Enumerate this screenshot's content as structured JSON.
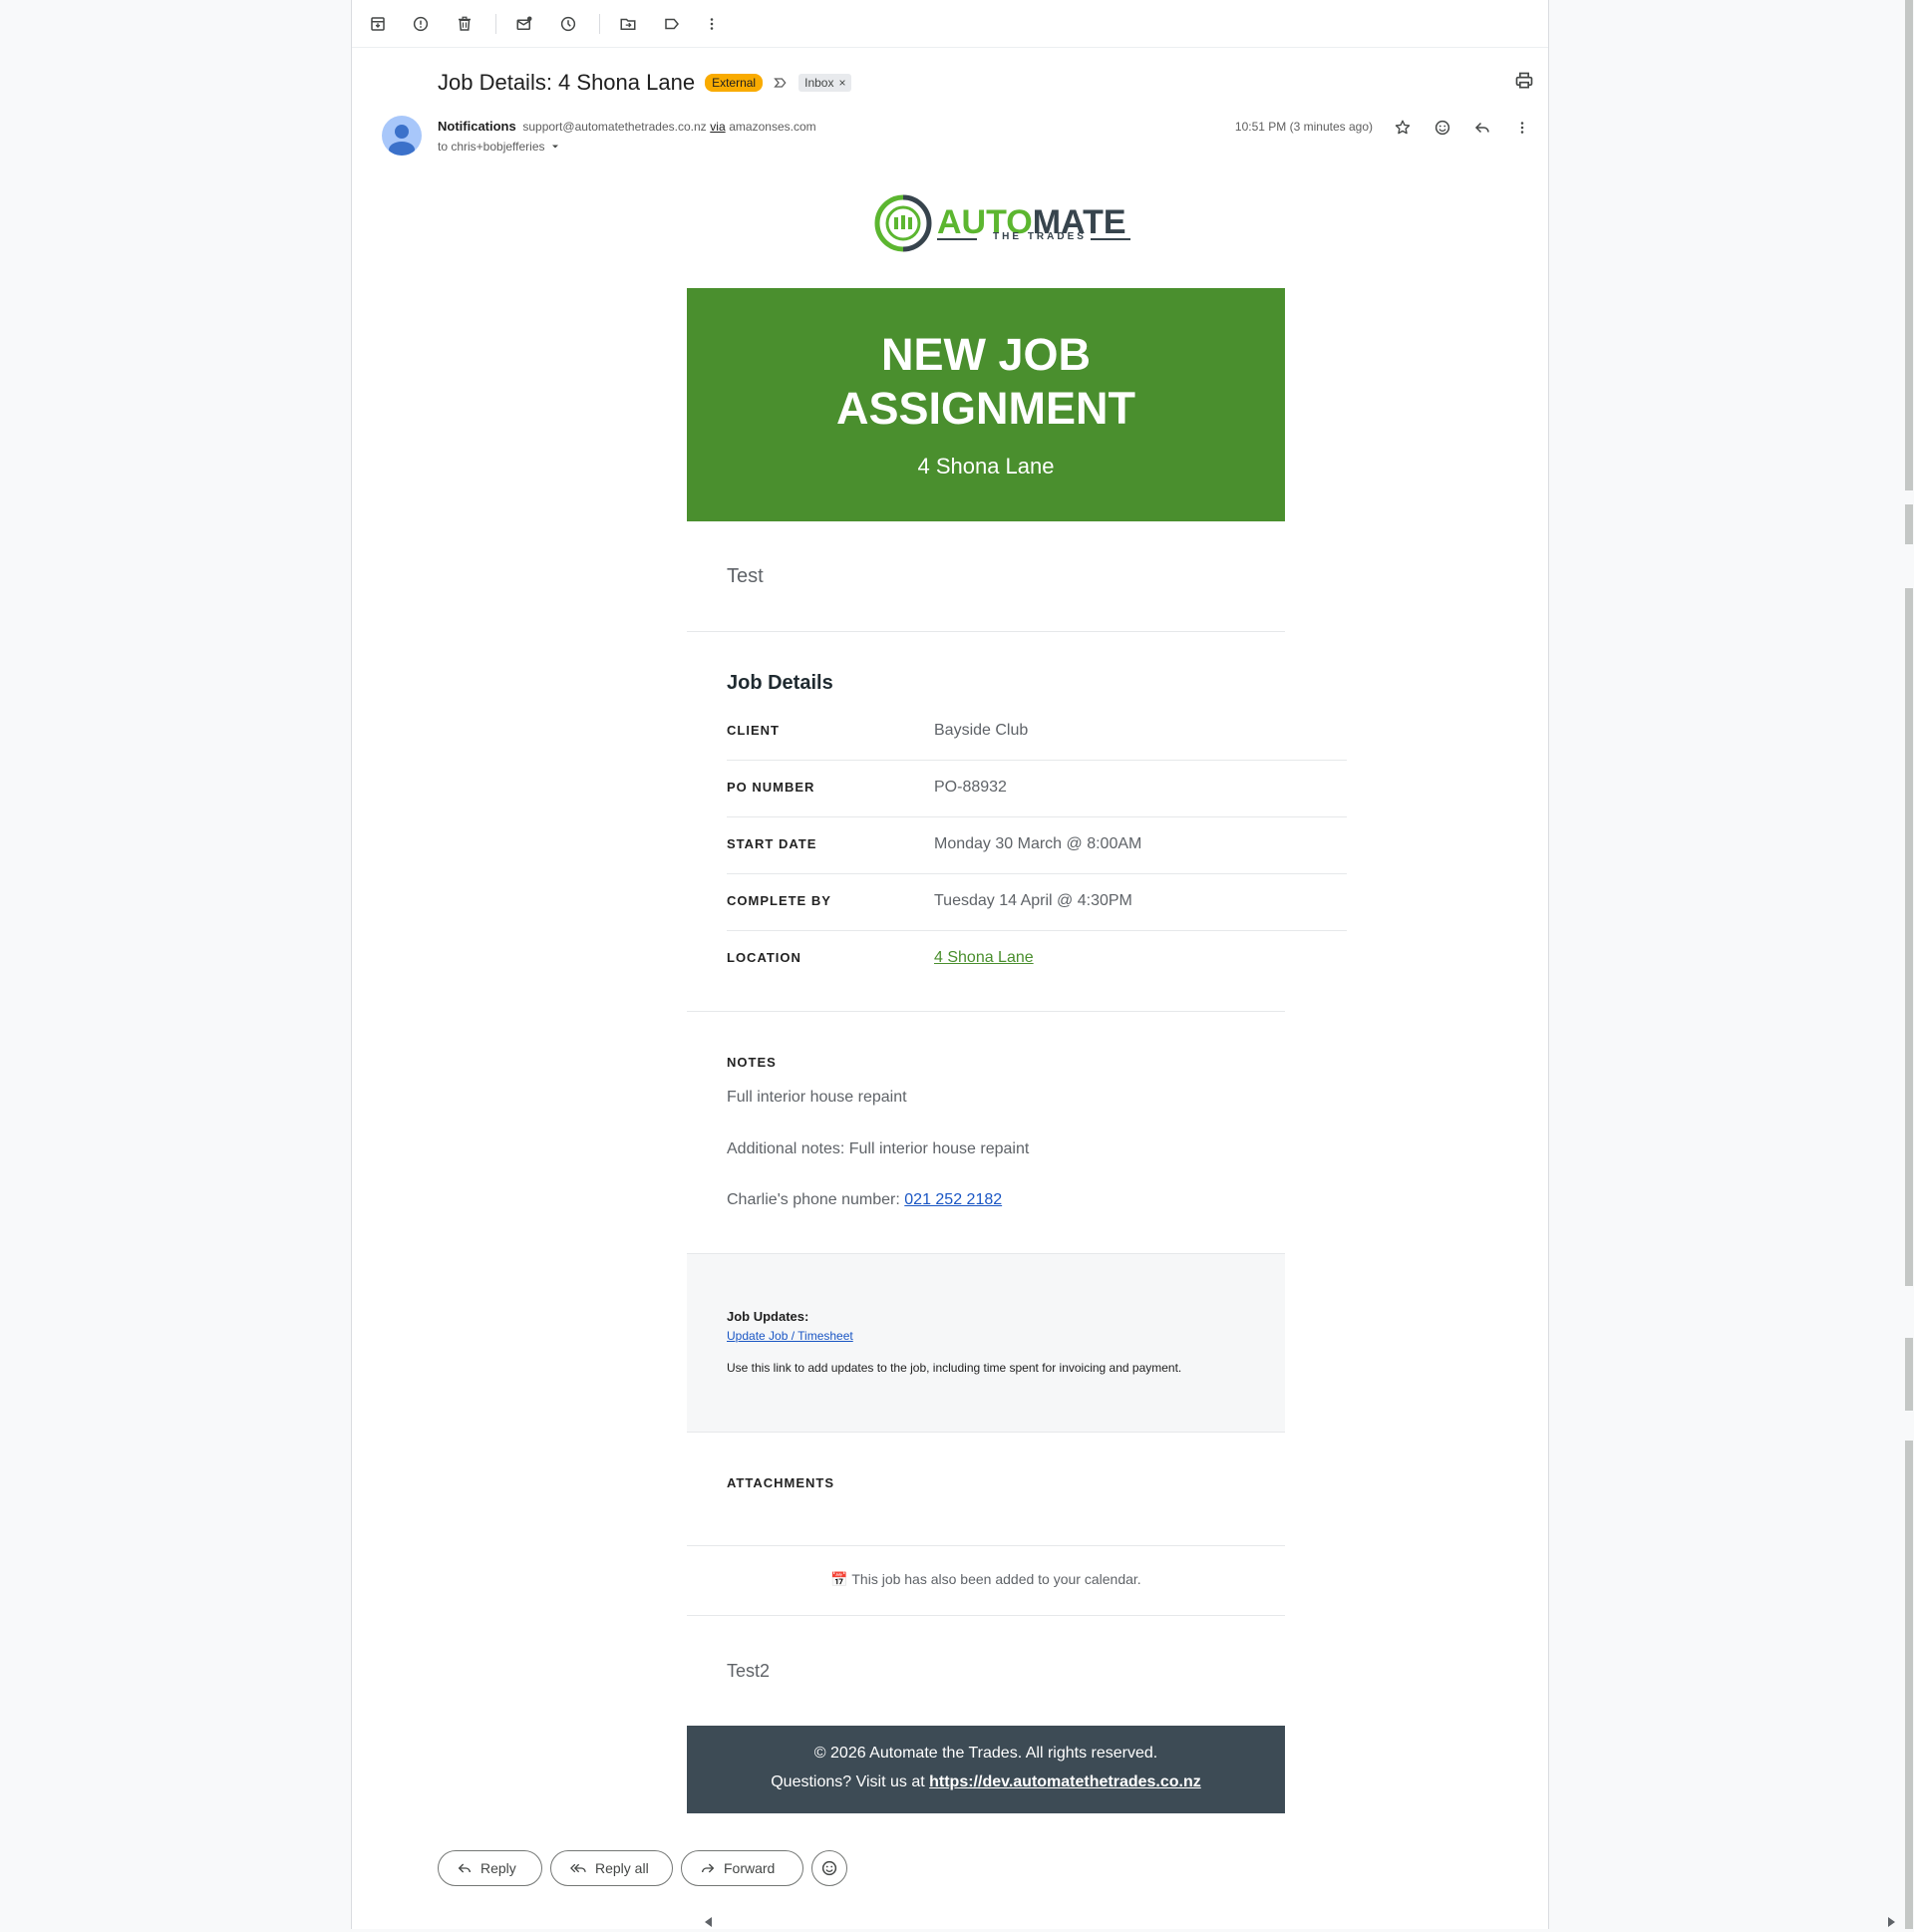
{
  "toolbar": {
    "icons": [
      "archive-icon",
      "report-spam-icon",
      "delete-icon",
      "mark-unread-icon",
      "snooze-icon",
      "move-to-icon",
      "label-icon",
      "more-vert-icon"
    ]
  },
  "header": {
    "subject": "Job Details: 4 Shona Lane",
    "external_badge": "External",
    "inbox_chip": "Inbox",
    "inbox_remove": "×",
    "sender_name": "Notifications",
    "sender_email": "support@automatethetrades.co.nz",
    "via": "via",
    "via_domain": "amazonses.com",
    "to_line": "to chris+bobjefferies",
    "timestamp": "10:51 PM (3 minutes ago)"
  },
  "logo": {
    "auto": "AUTO",
    "mate": "MATE",
    "tagline": "THE TRADES"
  },
  "banner": {
    "title_line1": "NEW JOB",
    "title_line2": "ASSIGNMENT",
    "subtitle": "4 Shona Lane",
    "color": "#4a8f2e"
  },
  "intro_text": "Test",
  "job_details": {
    "heading": "Job Details",
    "rows": [
      {
        "label": "CLIENT",
        "value": "Bayside Club"
      },
      {
        "label": "PO NUMBER",
        "value": "PO-88932"
      },
      {
        "label": "START DATE",
        "value": "Monday 30 March @ 8:00AM"
      },
      {
        "label": "COMPLETE BY",
        "value": "Tuesday 14 April @ 4:30PM"
      },
      {
        "label": "LOCATION",
        "value": "4 Shona Lane"
      }
    ]
  },
  "notes": {
    "label": "NOTES",
    "line1": "Full interior house repaint",
    "line2": "Additional notes: Full interior house repaint",
    "phone_prefix": "Charlie's phone number: ",
    "phone": "021 252 2182"
  },
  "updates": {
    "title": "Job Updates:",
    "link": "Update Job / Timesheet",
    "description": "Use this link to add updates to the job, including time spent for invoicing and payment."
  },
  "attachments_label": "ATTACHMENTS",
  "calendar_note": "📅 This job has also been added to your calendar.",
  "closing_text": "Test2",
  "footer": {
    "copyright": "© 2026 Automate the Trades. All rights reserved.",
    "questions_prefix": "Questions? Visit us at ",
    "url": "https://dev.automatethetrades.co.nz",
    "color": "#3d4b55"
  },
  "actions": {
    "reply": "Reply",
    "reply_all": "Reply all",
    "forward": "Forward"
  }
}
